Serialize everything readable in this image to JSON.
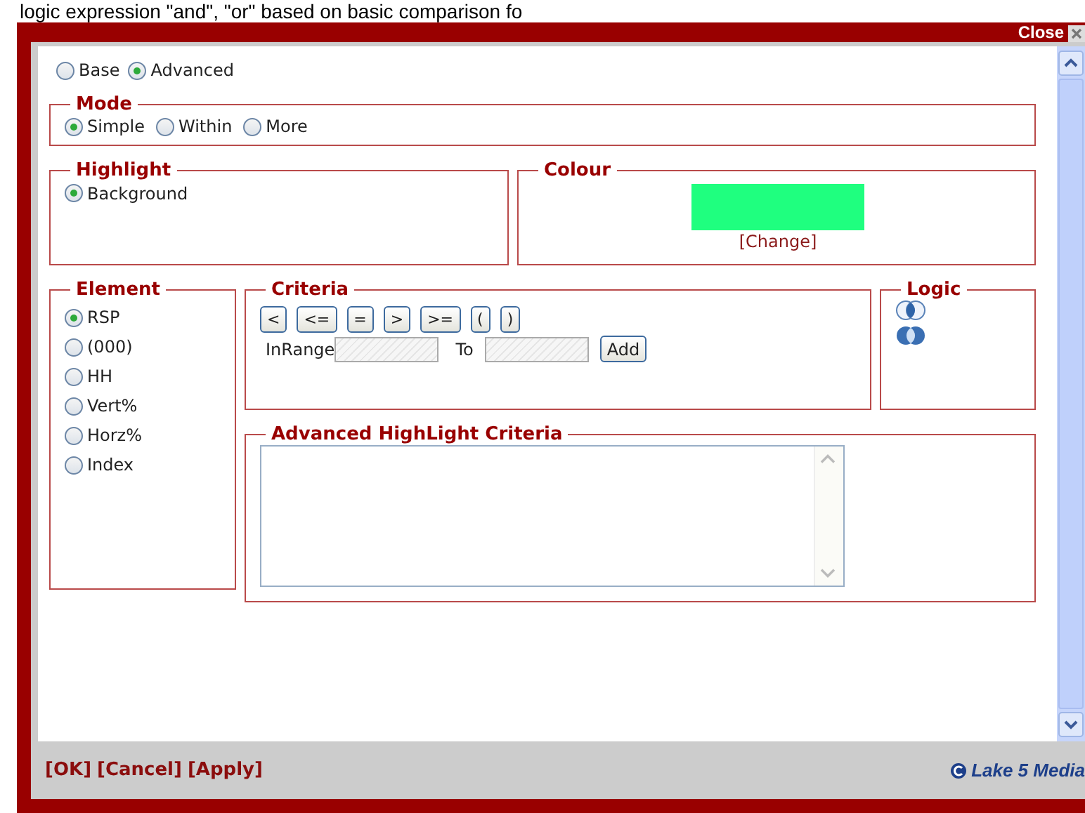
{
  "background_text": "logic expression \"and\", \"or\" based on basic comparison fo",
  "dialog": {
    "close_label": "Close"
  },
  "view_options": [
    {
      "label": "Base",
      "selected": false
    },
    {
      "label": "Advanced",
      "selected": true
    }
  ],
  "mode": {
    "legend": "Mode",
    "options": [
      {
        "label": "Simple",
        "selected": true
      },
      {
        "label": "Within",
        "selected": false
      },
      {
        "label": "More",
        "selected": false
      }
    ]
  },
  "highlight": {
    "legend": "Highlight",
    "options": [
      {
        "label": "Background",
        "selected": true
      }
    ]
  },
  "colour": {
    "legend": "Colour",
    "swatch": {
      "color": "#1fff7f"
    },
    "change_link": "[Change]"
  },
  "element": {
    "legend": "Element",
    "options": [
      {
        "label": "RSP",
        "selected": true
      },
      {
        "label": "(000)",
        "selected": false
      },
      {
        "label": "HH",
        "selected": false
      },
      {
        "label": "Vert%",
        "selected": false
      },
      {
        "label": "Horz%",
        "selected": false
      },
      {
        "label": "Index",
        "selected": false
      }
    ]
  },
  "criteria": {
    "legend": "Criteria",
    "operators": [
      "<",
      "<=",
      "=",
      ">",
      ">=",
      "(",
      ")"
    ],
    "range_label": "InRange",
    "to_label": "To",
    "add_button": "Add"
  },
  "logic": {
    "legend": "Logic"
  },
  "advanced": {
    "legend": "Advanced HighLight Criteria"
  },
  "footer": {
    "actions": [
      "[OK]",
      "[Cancel]",
      "[Apply]"
    ],
    "brand": "Lake 5 Media"
  }
}
